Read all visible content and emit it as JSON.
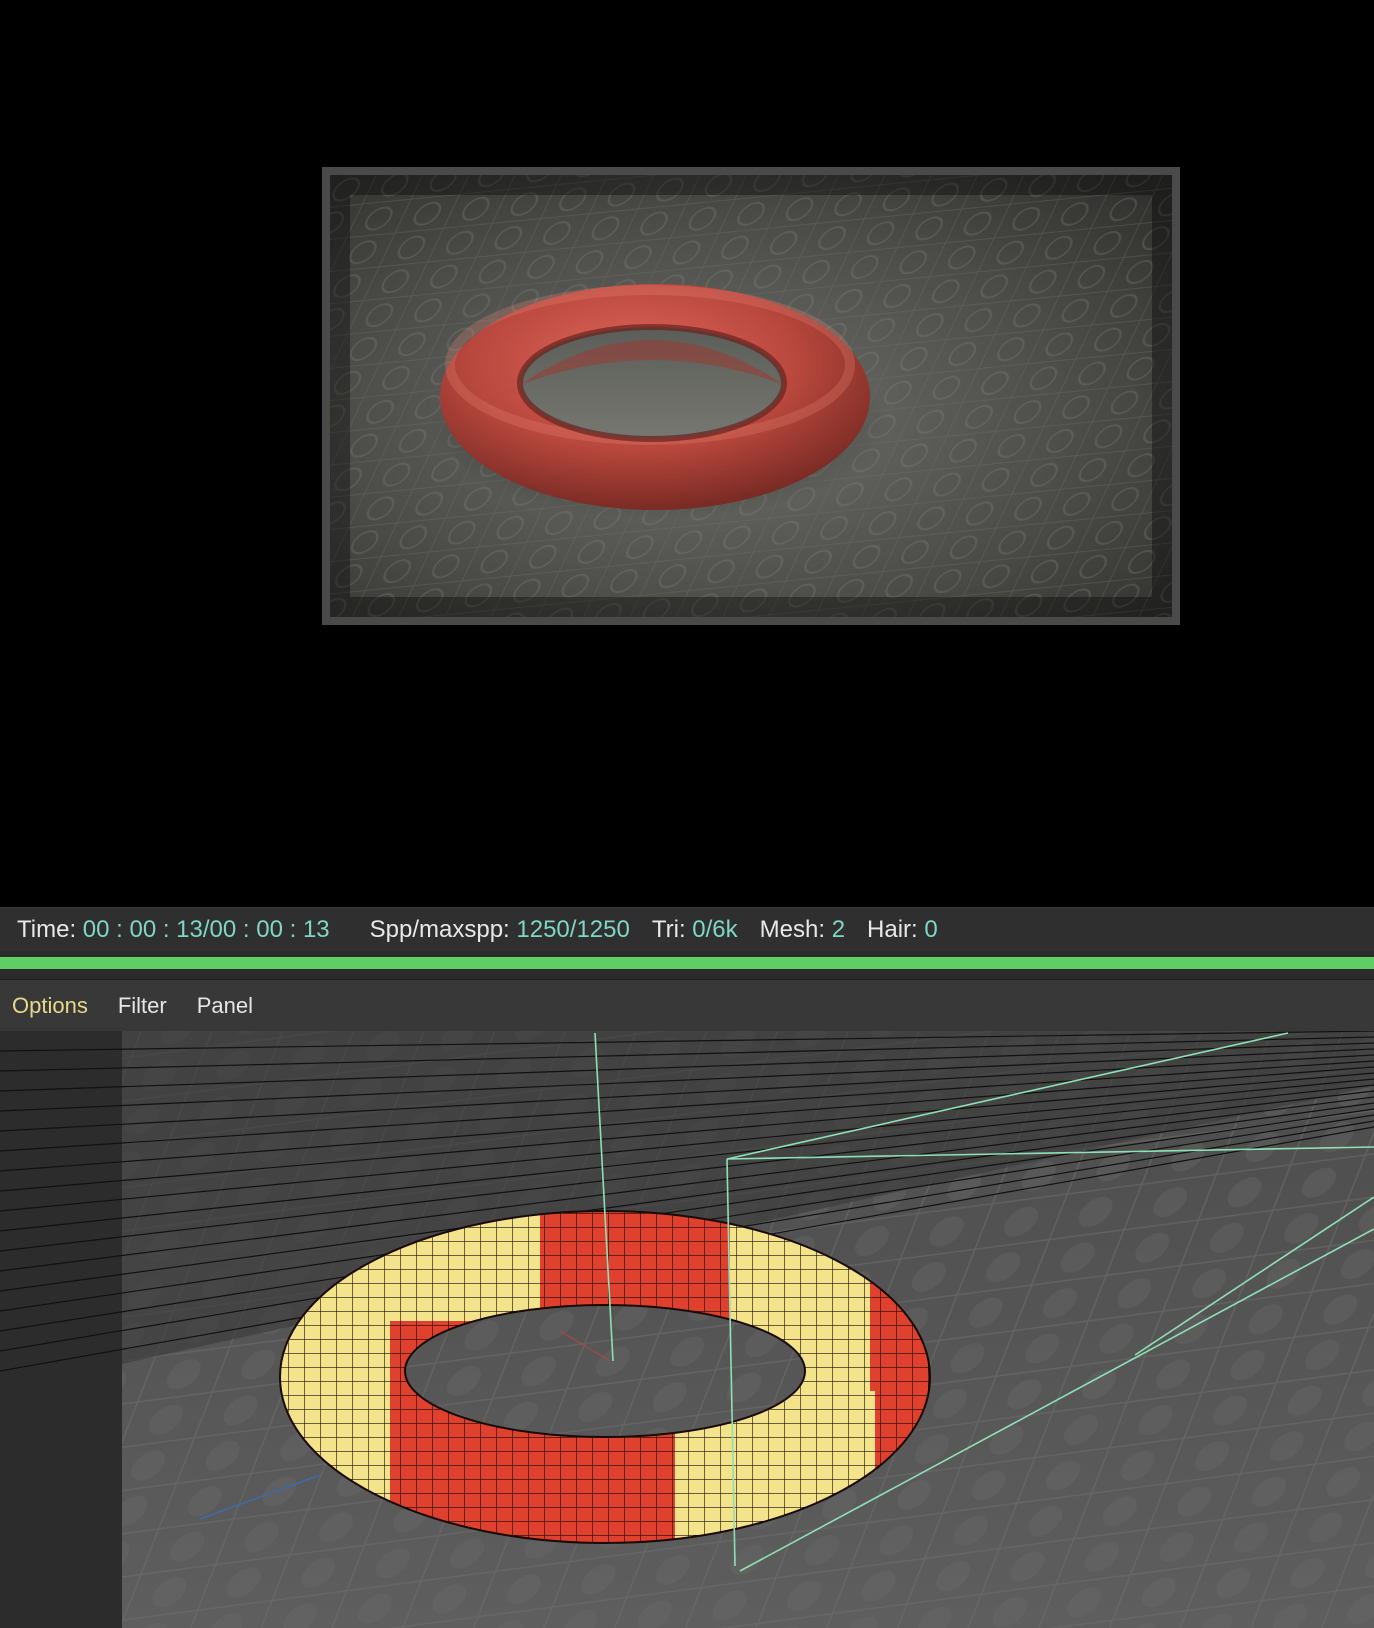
{
  "status": {
    "time_label": "Time:",
    "time_value": "00 : 00 : 13/00 : 00 : 13",
    "spp_label": "Spp/maxspp:",
    "spp_value": "1250/1250",
    "tri_label": "Tri:",
    "tri_value": "0/6k",
    "mesh_label": "Mesh:",
    "mesh_value": "2",
    "hair_label": "Hair:",
    "hair_value": "0"
  },
  "progress": {
    "fraction": 1.0,
    "color": "#5fce64"
  },
  "menu": {
    "items": [
      {
        "label": "Options"
      },
      {
        "label": "Filter"
      },
      {
        "label": "Panel"
      }
    ]
  },
  "colors": {
    "accent_value": "#7fd6c4",
    "active_menu": "#e8d88a",
    "torus_red": "#d9443a",
    "torus_yellow": "#f3e38a",
    "gizmo_green": "#8fe0b8"
  }
}
